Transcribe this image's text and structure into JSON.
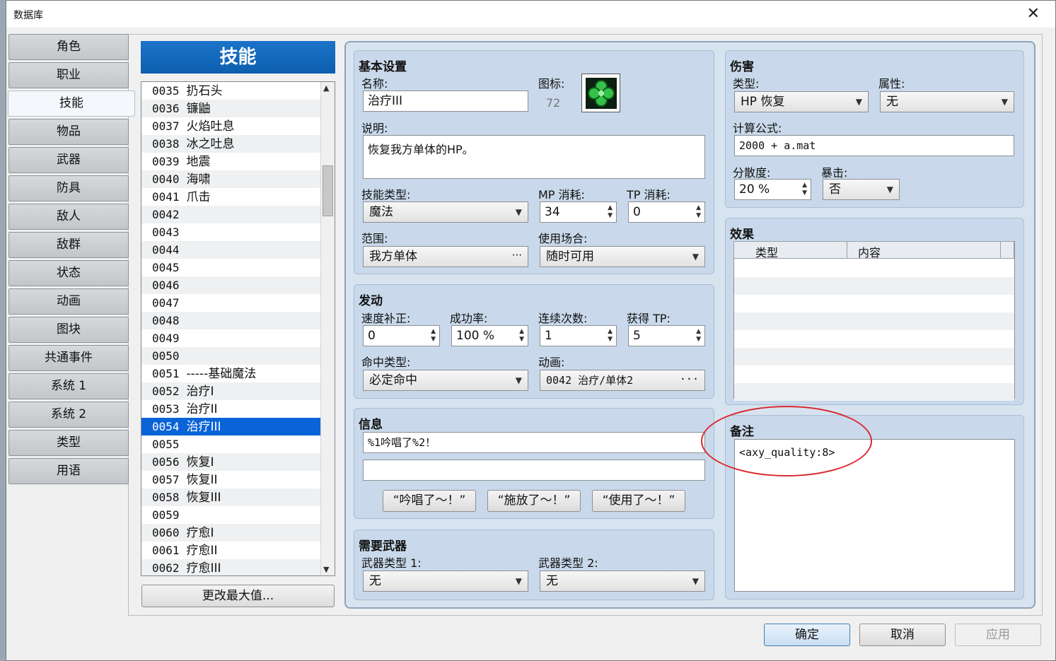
{
  "window": {
    "title": "数据库",
    "close_glyph": "✕"
  },
  "nav": {
    "items": [
      "角色",
      "职业",
      "技能",
      "物品",
      "武器",
      "防具",
      "敌人",
      "敌群",
      "状态",
      "动画",
      "图块",
      "共通事件",
      "系统 1",
      "系统 2",
      "类型",
      "用语"
    ],
    "active": "技能"
  },
  "list": {
    "header": "技能",
    "rows": [
      {
        "id": "0035",
        "name": "扔石头"
      },
      {
        "id": "0036",
        "name": "镰鼬"
      },
      {
        "id": "0037",
        "name": "火焰吐息"
      },
      {
        "id": "0038",
        "name": "冰之吐息"
      },
      {
        "id": "0039",
        "name": "地震"
      },
      {
        "id": "0040",
        "name": "海啸"
      },
      {
        "id": "0041",
        "name": "爪击"
      },
      {
        "id": "0042",
        "name": ""
      },
      {
        "id": "0043",
        "name": ""
      },
      {
        "id": "0044",
        "name": ""
      },
      {
        "id": "0045",
        "name": ""
      },
      {
        "id": "0046",
        "name": ""
      },
      {
        "id": "0047",
        "name": ""
      },
      {
        "id": "0048",
        "name": ""
      },
      {
        "id": "0049",
        "name": ""
      },
      {
        "id": "0050",
        "name": ""
      },
      {
        "id": "0051",
        "name": "-----基础魔法"
      },
      {
        "id": "0052",
        "name": "治疗I"
      },
      {
        "id": "0053",
        "name": "治疗II"
      },
      {
        "id": "0054",
        "name": "治疗III"
      },
      {
        "id": "0055",
        "name": ""
      },
      {
        "id": "0056",
        "name": "恢复I"
      },
      {
        "id": "0057",
        "name": "恢复II"
      },
      {
        "id": "0058",
        "name": "恢复III"
      },
      {
        "id": "0059",
        "name": ""
      },
      {
        "id": "0060",
        "name": "疗愈I"
      },
      {
        "id": "0061",
        "name": "疗愈II"
      },
      {
        "id": "0062",
        "name": "疗愈III"
      }
    ],
    "selected_id": "0054",
    "change_max_label": "更改最大值..."
  },
  "basic": {
    "title": "基本设置",
    "name_label": "名称:",
    "name_value": "治疗III",
    "icon_label": "图标:",
    "icon_index": "72",
    "icon_name": "clover-icon",
    "desc_label": "说明:",
    "desc_value": "恢复我方单体的HP。",
    "skill_type_label": "技能类型:",
    "skill_type_value": "魔法",
    "mp_label": "MP 消耗:",
    "mp_value": "34",
    "tp_label": "TP 消耗:",
    "tp_value": "0",
    "scope_label": "范围:",
    "scope_value": "我方单体",
    "occasion_label": "使用场合:",
    "occasion_value": "随时可用"
  },
  "invocation": {
    "title": "发动",
    "speed_label": "速度补正:",
    "speed_value": "0",
    "success_label": "成功率:",
    "success_value": "100 %",
    "repeat_label": "连续次数:",
    "repeat_value": "1",
    "tp_gain_label": "获得 TP:",
    "tp_gain_value": "5",
    "hit_type_label": "命中类型:",
    "hit_type_value": "必定命中",
    "animation_label": "动画:",
    "animation_value": "0042 治疗/单体2"
  },
  "message": {
    "title": "信息",
    "line1": "%1吟唱了%2！",
    "line2": "",
    "btn1": "“吟唱了～！”",
    "btn2": "“施放了～！”",
    "btn3": "“使用了～！”"
  },
  "weapons": {
    "title": "需要武器",
    "type1_label": "武器类型 1:",
    "type1_value": "无",
    "type2_label": "武器类型 2:",
    "type2_value": "无"
  },
  "damage": {
    "title": "伤害",
    "type_label": "类型:",
    "type_value": "HP 恢复",
    "element_label": "属性:",
    "element_value": "无",
    "formula_label": "计算公式:",
    "formula_value": "2000 + a.mat",
    "variance_label": "分散度:",
    "variance_value": "20 %",
    "critical_label": "暴击:",
    "critical_value": "否"
  },
  "effects": {
    "title": "效果",
    "col_type": "类型",
    "col_content": "内容"
  },
  "note": {
    "title": "备注",
    "value": "<axy_quality:8>",
    "highlight_color": "#d9282f"
  },
  "footer": {
    "ok": "确定",
    "cancel": "取消",
    "apply": "应用"
  }
}
